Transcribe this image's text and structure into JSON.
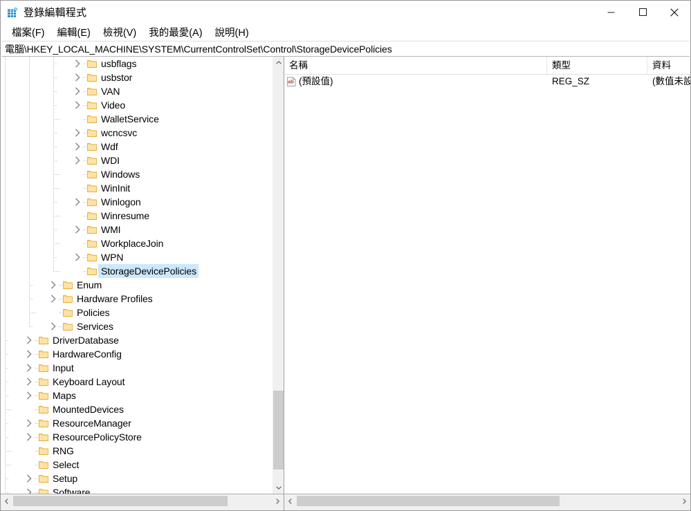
{
  "window": {
    "title": "登錄編輯程式",
    "app_icon": "registry-editor-icon"
  },
  "caption": {
    "minimize": "minimize-icon",
    "maximize": "maximize-icon",
    "close": "close-icon"
  },
  "menubar": {
    "items": [
      {
        "label": "檔案(F)"
      },
      {
        "label": "編輯(E)"
      },
      {
        "label": "檢視(V)"
      },
      {
        "label": "我的最愛(A)"
      },
      {
        "label": "說明(H)"
      }
    ]
  },
  "address": {
    "path": "電腦\\HKEY_LOCAL_MACHINE\\SYSTEM\\CurrentControlSet\\Control\\StorageDevicePolicies"
  },
  "tree": {
    "items": [
      {
        "label": "usbflags",
        "depth": 3,
        "expandable": true,
        "selected": false
      },
      {
        "label": "usbstor",
        "depth": 3,
        "expandable": true,
        "selected": false
      },
      {
        "label": "VAN",
        "depth": 3,
        "expandable": true,
        "selected": false
      },
      {
        "label": "Video",
        "depth": 3,
        "expandable": true,
        "selected": false
      },
      {
        "label": "WalletService",
        "depth": 3,
        "expandable": false,
        "selected": false
      },
      {
        "label": "wcncsvc",
        "depth": 3,
        "expandable": true,
        "selected": false
      },
      {
        "label": "Wdf",
        "depth": 3,
        "expandable": true,
        "selected": false
      },
      {
        "label": "WDI",
        "depth": 3,
        "expandable": true,
        "selected": false
      },
      {
        "label": "Windows",
        "depth": 3,
        "expandable": false,
        "selected": false
      },
      {
        "label": "WinInit",
        "depth": 3,
        "expandable": false,
        "selected": false
      },
      {
        "label": "Winlogon",
        "depth": 3,
        "expandable": true,
        "selected": false
      },
      {
        "label": "Winresume",
        "depth": 3,
        "expandable": false,
        "selected": false
      },
      {
        "label": "WMI",
        "depth": 3,
        "expandable": true,
        "selected": false
      },
      {
        "label": "WorkplaceJoin",
        "depth": 3,
        "expandable": false,
        "selected": false
      },
      {
        "label": "WPN",
        "depth": 3,
        "expandable": true,
        "selected": false
      },
      {
        "label": "StorageDevicePolicies",
        "depth": 3,
        "expandable": false,
        "selected": true
      },
      {
        "label": "Enum",
        "depth": 2,
        "expandable": true,
        "selected": false
      },
      {
        "label": "Hardware Profiles",
        "depth": 2,
        "expandable": true,
        "selected": false
      },
      {
        "label": "Policies",
        "depth": 2,
        "expandable": false,
        "selected": false
      },
      {
        "label": "Services",
        "depth": 2,
        "expandable": true,
        "selected": false
      },
      {
        "label": "DriverDatabase",
        "depth": 1,
        "expandable": true,
        "selected": false
      },
      {
        "label": "HardwareConfig",
        "depth": 1,
        "expandable": true,
        "selected": false
      },
      {
        "label": "Input",
        "depth": 1,
        "expandable": true,
        "selected": false
      },
      {
        "label": "Keyboard Layout",
        "depth": 1,
        "expandable": true,
        "selected": false
      },
      {
        "label": "Maps",
        "depth": 1,
        "expandable": true,
        "selected": false
      },
      {
        "label": "MountedDevices",
        "depth": 1,
        "expandable": false,
        "selected": false
      },
      {
        "label": "ResourceManager",
        "depth": 1,
        "expandable": true,
        "selected": false
      },
      {
        "label": "ResourcePolicyStore",
        "depth": 1,
        "expandable": true,
        "selected": false
      },
      {
        "label": "RNG",
        "depth": 1,
        "expandable": false,
        "selected": false
      },
      {
        "label": "Select",
        "depth": 1,
        "expandable": false,
        "selected": false
      },
      {
        "label": "Setup",
        "depth": 1,
        "expandable": true,
        "selected": false
      },
      {
        "label": "Software",
        "depth": 1,
        "expandable": true,
        "selected": false
      }
    ]
  },
  "list": {
    "columns": [
      {
        "label": "名稱"
      },
      {
        "label": "類型"
      },
      {
        "label": "資料"
      }
    ],
    "rows": [
      {
        "icon": "string-value-icon",
        "name": "(預設值)",
        "type": "REG_SZ",
        "data": "(數值未設"
      }
    ]
  },
  "colors": {
    "selection": "#cce8ff",
    "folder": "#ffd67a",
    "scrollbar_thumb": "#cdcdcd",
    "scrollbar_track": "#f0f0f0",
    "icon_red": "#c0392b"
  }
}
